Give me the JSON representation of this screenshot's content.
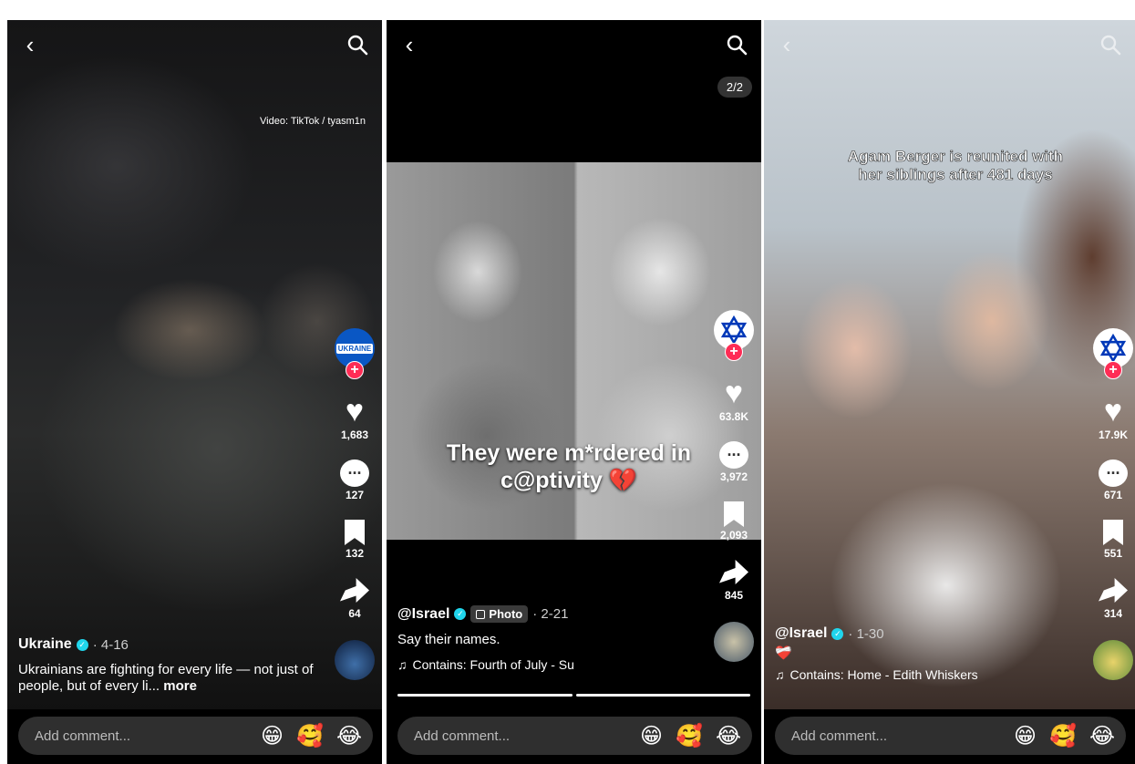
{
  "panels": [
    {
      "credit": "Video: TikTok / tyasm1n",
      "avatar_text": "UKRAINE",
      "likes": "1,683",
      "comments": "127",
      "saves": "132",
      "shares": "64",
      "username": "Ukraine",
      "date": "· 4-16",
      "description": "Ukrainians are fighting for every life — not just of people, but of every li...",
      "more": "more",
      "comment_placeholder": "Add comment..."
    },
    {
      "page_count": "2/2",
      "overlay": "They were m*rdered in c@ptivity 💔",
      "likes": "63.8K",
      "comments": "3,972",
      "saves": "2,093",
      "shares": "845",
      "username": "@Israel",
      "photo_badge": "Photo",
      "date": "· 2-21",
      "description": "Say their names.",
      "music": "Contains: Fourth of July - Su",
      "comment_placeholder": "Add comment..."
    },
    {
      "overlay": "Agam Berger is reunited with her siblings after 481 days",
      "likes": "17.9K",
      "comments": "671",
      "saves": "551",
      "shares": "314",
      "username": "@Israel",
      "date": "· 1-30",
      "description": "❤️‍🩹",
      "music": "Contains: Home - Edith Whiskers",
      "comment_placeholder": "Add comment..."
    }
  ],
  "icons": {
    "back": "‹",
    "search": "⌕",
    "heart": "♥",
    "music": "♫",
    "emojis": [
      "😁",
      "🥰",
      "😂"
    ]
  },
  "colors": {
    "follow": "#fe2c55",
    "verified": "#20d5ec",
    "israel_blue": "#0038b8"
  }
}
